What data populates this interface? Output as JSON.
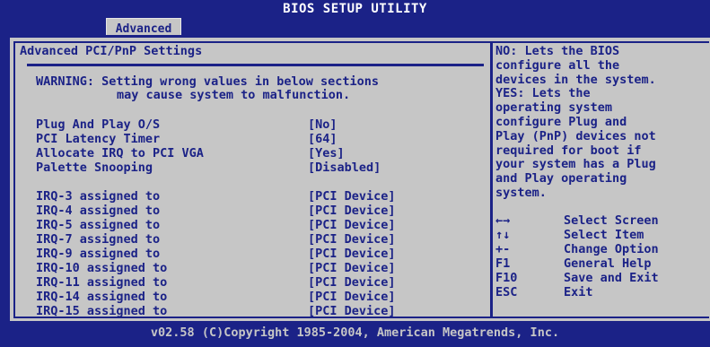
{
  "header": {
    "title": "BIOS SETUP UTILITY",
    "active_tab": "Advanced"
  },
  "section": {
    "title": "Advanced PCI/PnP Settings",
    "warning_line1": "WARNING: Setting wrong values in below sections",
    "warning_line2": "may cause system to malfunction."
  },
  "settings": [
    {
      "label": "Plug And Play O/S",
      "value": "[No]"
    },
    {
      "label": "PCI Latency Timer",
      "value": "[64]"
    },
    {
      "label": "Allocate IRQ to PCI VGA",
      "value": "[Yes]"
    },
    {
      "label": "Palette Snooping",
      "value": "[Disabled]"
    }
  ],
  "irq_settings": [
    {
      "label": "IRQ-3 assigned to",
      "value": "[PCI Device]"
    },
    {
      "label": "IRQ-4 assigned to",
      "value": "[PCI Device]"
    },
    {
      "label": "IRQ-5 assigned to",
      "value": "[PCI Device]"
    },
    {
      "label": "IRQ-7 assigned to",
      "value": "[PCI Device]"
    },
    {
      "label": "IRQ-9 assigned to",
      "value": "[PCI Device]"
    },
    {
      "label": "IRQ-10 assigned to",
      "value": "[PCI Device]"
    },
    {
      "label": "IRQ-11 assigned to",
      "value": "[PCI Device]"
    },
    {
      "label": "IRQ-14 assigned to",
      "value": "[PCI Device]"
    },
    {
      "label": "IRQ-15 assigned to",
      "value": "[PCI Device]"
    }
  ],
  "help": {
    "lines": [
      "NO: Lets the BIOS",
      "configure all the",
      "devices in the system.",
      "YES: Lets the",
      "operating system",
      "configure Plug and",
      "Play (PnP) devices not",
      "required for boot if",
      "your system has a Plug",
      "and Play operating",
      "system."
    ]
  },
  "keys": [
    {
      "key": "←→",
      "desc": "Select Screen"
    },
    {
      "key": "↑↓",
      "desc": "Select Item"
    },
    {
      "key": "+-",
      "desc": "Change Option"
    },
    {
      "key": "F1",
      "desc": "General Help"
    },
    {
      "key": "F10",
      "desc": "Save and Exit"
    },
    {
      "key": "ESC",
      "desc": "Exit"
    }
  ],
  "footer": {
    "text": "v02.58 (C)Copyright 1985-2004, American Megatrends, Inc."
  },
  "colors": {
    "background": "#1b2287",
    "panel": "#c6c6c6",
    "text": "#1b2287"
  }
}
